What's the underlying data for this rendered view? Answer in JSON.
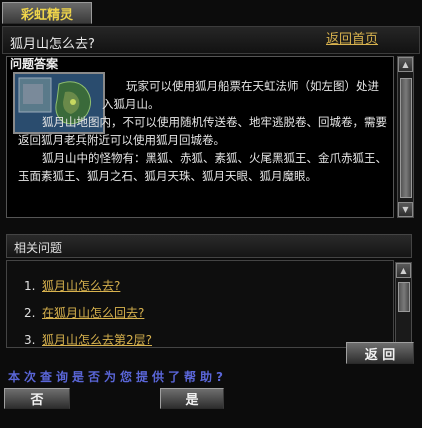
{
  "window": {
    "tab_label": "彩虹精灵"
  },
  "header": {
    "question": "狐月山怎么去?",
    "home_link": "返回首页"
  },
  "answer": {
    "heading": "问题答案",
    "paragraphs": [
      "玩家可以使用狐月船票在天虹法师（如左图）处进入狐月山。",
      "狐月山地图内，不可以使用随机传送卷、地牢逃脱卷、回城卷，需要返回狐月老兵附近可以使用狐月回城卷。",
      "狐月山中的怪物有：黑狐、赤狐、素狐、火尾黑狐王、金爪赤狐王、玉面素狐王、狐月之石、狐月天珠、狐月天眼、狐月魔眼。"
    ]
  },
  "related": {
    "title": "相关问题",
    "items": [
      {
        "num": "1.",
        "label": "狐月山怎么去?"
      },
      {
        "num": "2.",
        "label": "在狐月山怎么回去?"
      },
      {
        "num": "3.",
        "label": "狐月山怎么去第2层?"
      }
    ],
    "back_button": "返 回"
  },
  "feedback": {
    "prompt": "本次查询是否为您提供了帮助?",
    "no_button": "否",
    "yes_button": "是"
  },
  "icons": {
    "scroll_up": "up-arrow-icon",
    "scroll_down": "down-arrow-icon"
  }
}
